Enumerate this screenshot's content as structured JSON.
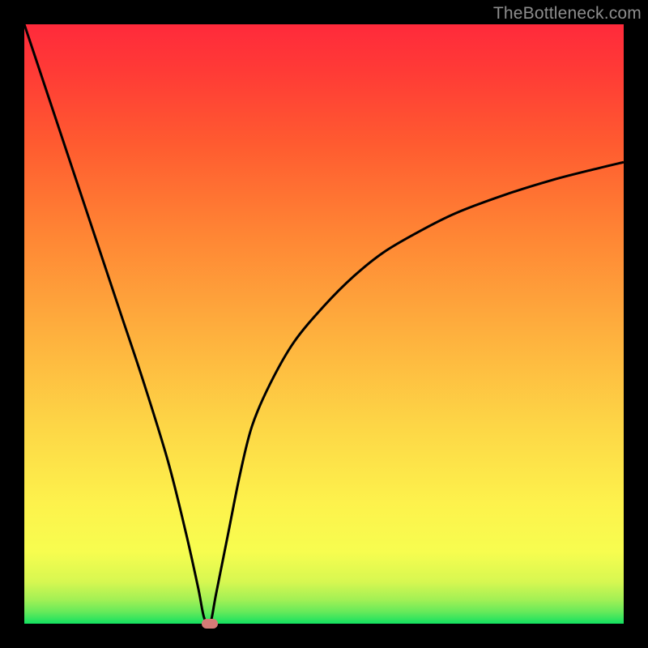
{
  "watermark": "TheBottleneck.com",
  "colors": {
    "line": "#000000",
    "marker": "#d57b77",
    "frame": "#000000"
  },
  "chart_data": {
    "type": "line",
    "title": "",
    "xlabel": "",
    "ylabel": "",
    "xlim": [
      0,
      100
    ],
    "ylim": [
      0,
      100
    ],
    "legend": false,
    "grid": false,
    "series": [
      {
        "name": "bottleneck-curve",
        "x": [
          0,
          2,
          5,
          8,
          12,
          16,
          20,
          24,
          27,
          29,
          30,
          31,
          32,
          34,
          36,
          38,
          41,
          45,
          50,
          55,
          60,
          66,
          72,
          80,
          88,
          95,
          100
        ],
        "y": [
          100,
          94,
          85,
          76,
          64,
          52,
          40,
          27,
          15,
          6,
          1,
          0,
          5,
          15,
          25,
          33,
          40,
          47,
          53,
          58,
          62,
          65.5,
          68.5,
          71.5,
          74,
          75.8,
          77
        ]
      }
    ],
    "annotations": [
      {
        "name": "minimum-marker",
        "x": 31,
        "y": 0,
        "shape": "rounded-rect",
        "color": "#d57b77"
      }
    ]
  }
}
